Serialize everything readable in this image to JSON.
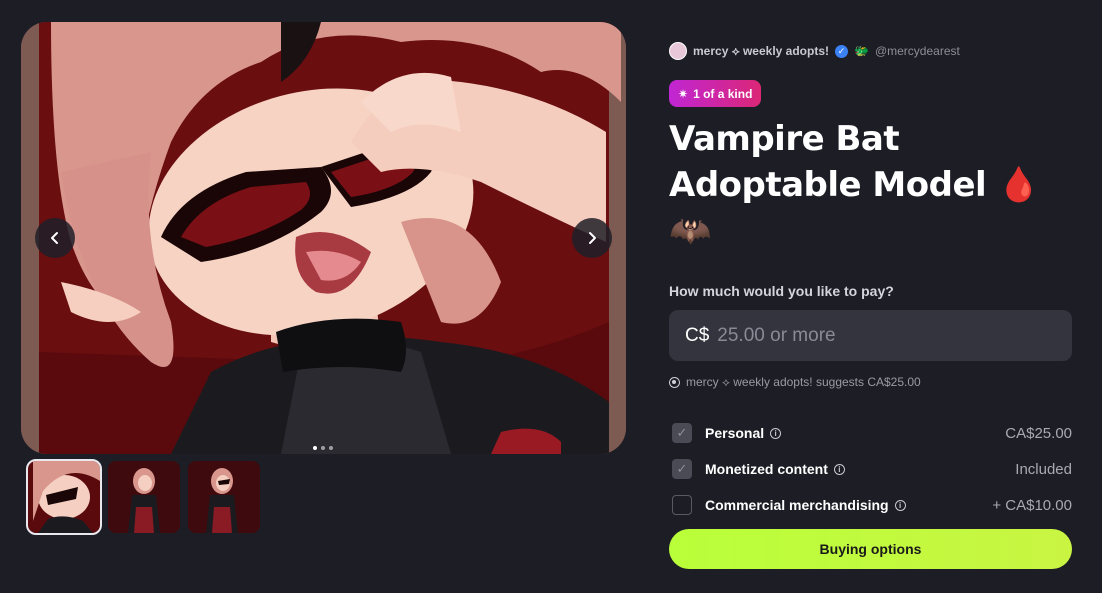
{
  "creator": {
    "name": "mercy ⟡ weekly adopts!",
    "handle": "@mercydearest"
  },
  "badge": {
    "label": "1 of a kind"
  },
  "product": {
    "title_line1": "Vampire Bat",
    "title_line2": "Adoptable Model 🩸",
    "title_line3": "🦇"
  },
  "pricing": {
    "question": "How much would you like to pay?",
    "currency": "C$",
    "placeholder": "25.00 or more",
    "suggestion": "mercy ⟡ weekly adopts! suggests CA$25.00"
  },
  "options": [
    {
      "label": "Personal",
      "price": "CA$25.00",
      "checked": true
    },
    {
      "label": "Monetized content",
      "price": "Included",
      "checked": true
    },
    {
      "label": "Commercial merchandising",
      "price": "+ CA$10.00",
      "checked": false
    }
  ],
  "buy_button": {
    "label": "Buying options"
  },
  "gallery": {
    "image_count": 3,
    "active_index": 0
  },
  "colors": {
    "accent": "#c0f540",
    "badge_start": "#c026d3",
    "badge_end": "#db2777",
    "background": "#1d1d26"
  },
  "icons": [
    "chevron-left-icon",
    "chevron-right-icon",
    "verified-icon",
    "sparkle-icon",
    "info-icon",
    "suggest-icon"
  ]
}
